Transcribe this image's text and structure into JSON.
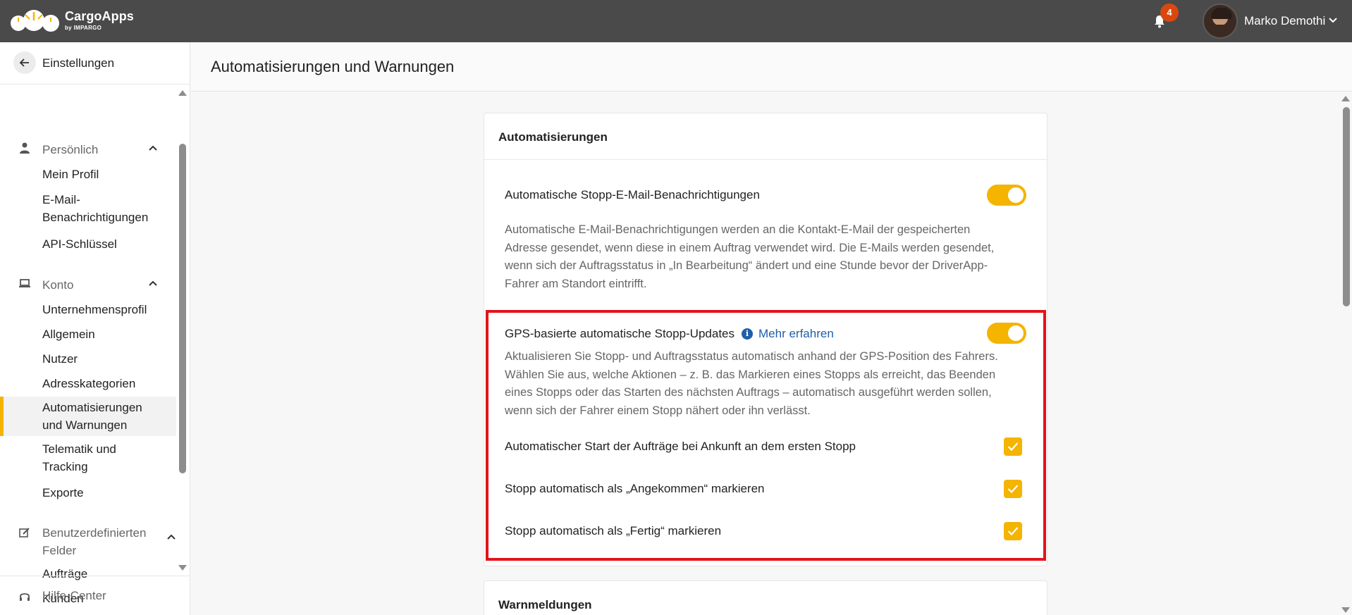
{
  "app": {
    "brand": "CargoApps",
    "brand_sub": "by IMPARGO",
    "notification_count": "4",
    "user_name": "Marko Demothi"
  },
  "sidebar": {
    "back_label": "Einstellungen",
    "sections": [
      {
        "label": "Persönlich",
        "icon": "person-icon",
        "items": [
          "Mein Profil",
          "E-Mail-\nBenachrichtigungen",
          "API-Schlüssel"
        ]
      },
      {
        "label": "Konto",
        "icon": "laptop-icon",
        "items": [
          "Unternehmensprofil",
          "Allgemein",
          "Nutzer",
          "Adresskategorien",
          "Automatisierungen und Warnungen",
          "Telematik und Tracking",
          "Exporte"
        ]
      },
      {
        "label": "Benutzerdefinierten Felder",
        "icon": "edit-icon",
        "items": [
          "Aufträge",
          "Kunden"
        ]
      }
    ],
    "active_item": "Automatisierungen und Warnungen",
    "help_label": "Hilfe-Center"
  },
  "page": {
    "title": "Automatisierungen und Warnungen"
  },
  "automations_card": {
    "title": "Automatisierungen",
    "email_toggle": {
      "label": "Automatische Stopp-E-Mail-Benachrichtigungen",
      "enabled": true,
      "description": "Automatische E-Mail-Benachrichtigungen werden an die Kontakt-E-Mail der gespeicherten Adresse gesendet, wenn diese in einem Auftrag verwendet wird. Die E-Mails werden gesendet, wenn sich der Auftragsstatus in „In Bearbeitung“ ändert und eine Stunde bevor der DriverApp-Fahrer am Standort eintrifft."
    },
    "gps_toggle": {
      "label": "GPS-basierte automatische Stopp-Updates",
      "link": "Mehr erfahren",
      "enabled": true,
      "description": "Aktualisieren Sie Stopp- und Auftragsstatus automatisch anhand der GPS-Position des Fahrers. Wählen Sie aus, welche Aktionen – z. B. das Markieren eines Stopps als erreicht, das Beenden eines Stopps oder das Starten des nächsten Auftrags – automatisch ausgeführt werden sollen, wenn sich der Fahrer einem Stopp nähert oder ihn verlässt.",
      "options": [
        {
          "label": "Automatischer Start der Aufträge bei Ankunft an dem ersten Stopp",
          "checked": true
        },
        {
          "label": "Stopp automatisch als „Angekommen“ markieren",
          "checked": true
        },
        {
          "label": "Stopp automatisch als „Fertig“ markieren",
          "checked": true
        }
      ]
    }
  },
  "warnings_card": {
    "title": "Warnmeldungen"
  },
  "colors": {
    "accent": "#f4b400",
    "topbar": "#4a4a4a",
    "link": "#1f5fa8",
    "highlight": "#e3141b",
    "badge": "#d9480f"
  }
}
